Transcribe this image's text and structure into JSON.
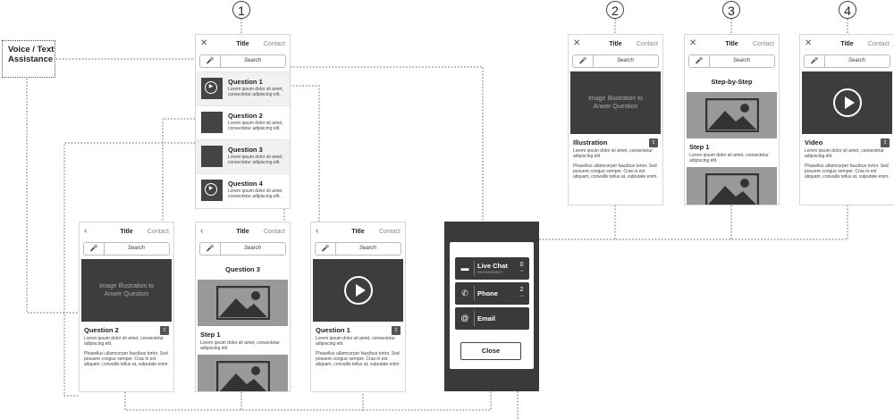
{
  "note": {
    "label": "Voice / Text Assistance"
  },
  "markers": [
    "1",
    "2",
    "3",
    "4"
  ],
  "common": {
    "contact": "Contact",
    "search": "Search",
    "title": "Title"
  },
  "lorem_short": "Lorem ipsum dolor sit amet, consectetur adipiscing elit.",
  "lorem_long": "Phasellus ullamcorper faucibus tortor. Sed posuere congue semper. Cras in est aliquam, convallis tellus at, vulputate enim.",
  "list": {
    "items": [
      {
        "title": "Question 1",
        "type": "video"
      },
      {
        "title": "Question 2",
        "type": "image"
      },
      {
        "title": "Question 3",
        "type": "image"
      },
      {
        "title": "Question 4",
        "type": "video"
      }
    ]
  },
  "illustration": {
    "placeholder": "Image Illustration to Anwer Question",
    "section": "Illustration"
  },
  "stepbystep": {
    "header": "Step-by-Step",
    "step": "Step 1"
  },
  "video": {
    "section": "Video"
  },
  "q2": {
    "placeholder": "Image Illustration to Anwer Question",
    "section": "Question 2"
  },
  "q3": {
    "header": "Question 3",
    "step": "Step 1"
  },
  "q1": {
    "section": "Question 1"
  },
  "contact_panel": {
    "live_chat": {
      "label": "Live Chat",
      "sub": "RECOMMENDED",
      "num": "0",
      "unit": "min"
    },
    "phone": {
      "label": "Phone",
      "num": "2",
      "unit": "min"
    },
    "email": {
      "label": "Email"
    },
    "close": "Close"
  }
}
